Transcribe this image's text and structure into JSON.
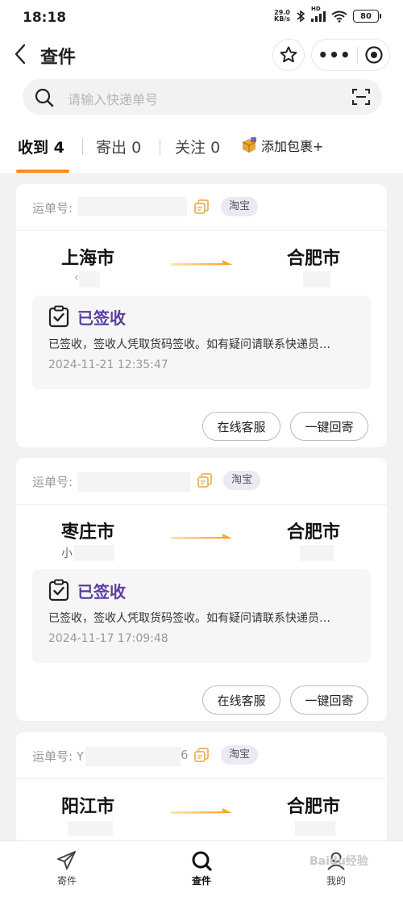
{
  "status_bar": {
    "time": "18:18",
    "speed_value": "29.0",
    "speed_unit": "KB/s",
    "signal_label": "HD",
    "battery": "80"
  },
  "nav": {
    "title": "查件",
    "more": "•••"
  },
  "search": {
    "placeholder": "请输入快递单号"
  },
  "tabs": [
    {
      "label": "收到",
      "count": "4"
    },
    {
      "label": "寄出",
      "count": "0"
    },
    {
      "label": "关注",
      "count": "0"
    }
  ],
  "add_package": "添加包裹+",
  "cards": [
    {
      "waybill_label": "运单号:",
      "waybill_partial_end": "",
      "tag": "淘宝",
      "from_city": "上海市",
      "from_sub": "‹",
      "to_city": "合肥市",
      "status": "已签收",
      "desc": "已签收，签收人凭取货码签收。如有疑问请联系快递员…",
      "time": "2024-11-21 12:35:47",
      "btn_service": "在线客服",
      "btn_return": "一键回寄"
    },
    {
      "waybill_label": "运单号:",
      "waybill_partial_end": "",
      "tag": "淘宝",
      "from_city": "枣庄市",
      "from_sub": "小",
      "to_city": "合肥市",
      "status": "已签收",
      "desc": "已签收，签收人凭取货码签收。如有疑问请联系快递员…",
      "time": "2024-11-17 17:09:48",
      "btn_service": "在线客服",
      "btn_return": "一键回寄"
    },
    {
      "waybill_label": "运单号: Y",
      "waybill_partial_end": "6",
      "tag": "淘宝",
      "from_city": "阳江市",
      "from_sub": "",
      "to_city": "合肥市"
    }
  ],
  "bottom_nav": [
    {
      "label": "寄件"
    },
    {
      "label": "查件"
    },
    {
      "label": "我的"
    }
  ],
  "watermark": "Baidu经验",
  "colors": {
    "accent": "#ff8c1a",
    "status_purple": "#5a3fa0",
    "tag_bg": "#ece8f4"
  }
}
